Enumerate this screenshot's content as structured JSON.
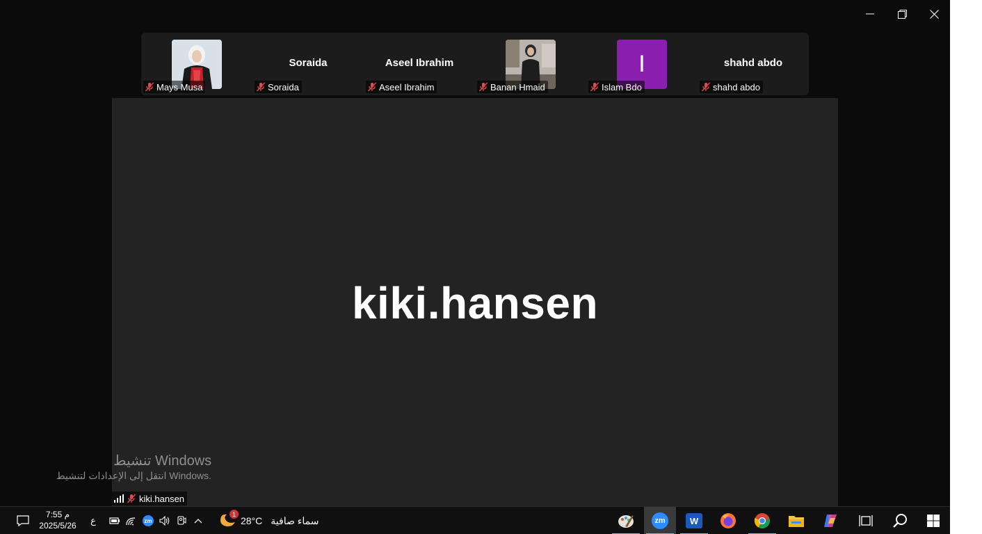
{
  "participants": [
    {
      "name": "Mays Musa",
      "tile_text": "",
      "type": "video"
    },
    {
      "name": "Soraida",
      "tile_text": "Soraida",
      "type": "name"
    },
    {
      "name": "Aseel Ibrahim",
      "tile_text": "Aseel Ibrahim",
      "type": "name"
    },
    {
      "name": "Banan Hmaid",
      "tile_text": "",
      "type": "video"
    },
    {
      "name": "Islam Bdo",
      "tile_text": "I",
      "type": "initial"
    },
    {
      "name": "shahd abdo",
      "tile_text": "shahd abdo",
      "type": "name"
    }
  ],
  "main": {
    "speaker_name": "kiki.hansen",
    "label": "kiki.hansen"
  },
  "watermark": {
    "line1": "تنشيط Windows",
    "line2": "انتقل إلى الإعدادات لتنشيط Windows."
  },
  "taskbar": {
    "time": "7:55 م",
    "date": "2025/5/26",
    "language": "ع",
    "temperature": "28°C",
    "weather_text": "سماء صافية",
    "weather_badge": "1",
    "zoom_label": "zm",
    "zoom_tray_label": "zm",
    "word_label": "W"
  },
  "colors": {
    "initial_tile": "#8b1fb0",
    "muted_icon": "#e5484d",
    "active_underline": "#7ab8f5"
  }
}
